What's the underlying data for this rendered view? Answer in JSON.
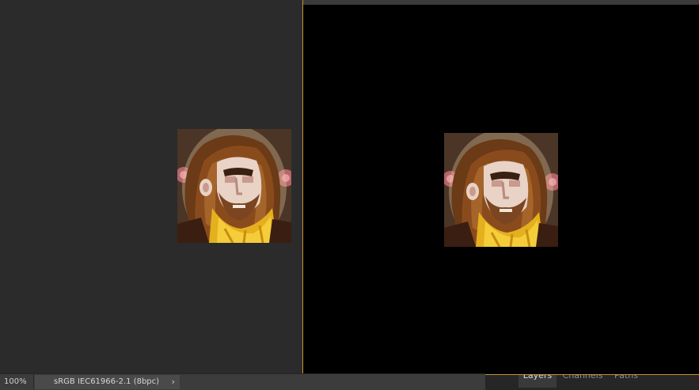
{
  "status_bar": {
    "zoom": "100%",
    "document_profile": "sRGB IEC61966-2.1 (8bpc)",
    "menu_arrow": "›"
  },
  "panel_tabs": [
    "Layers",
    "Channels",
    "Paths"
  ],
  "colors": {
    "canvas_left": "#2b2b2b",
    "canvas_right": "#000000",
    "window_border": "#c8902f",
    "status_bar": "#3c3c3c"
  },
  "icons": {
    "status_menu": "chevron-right-icon"
  }
}
